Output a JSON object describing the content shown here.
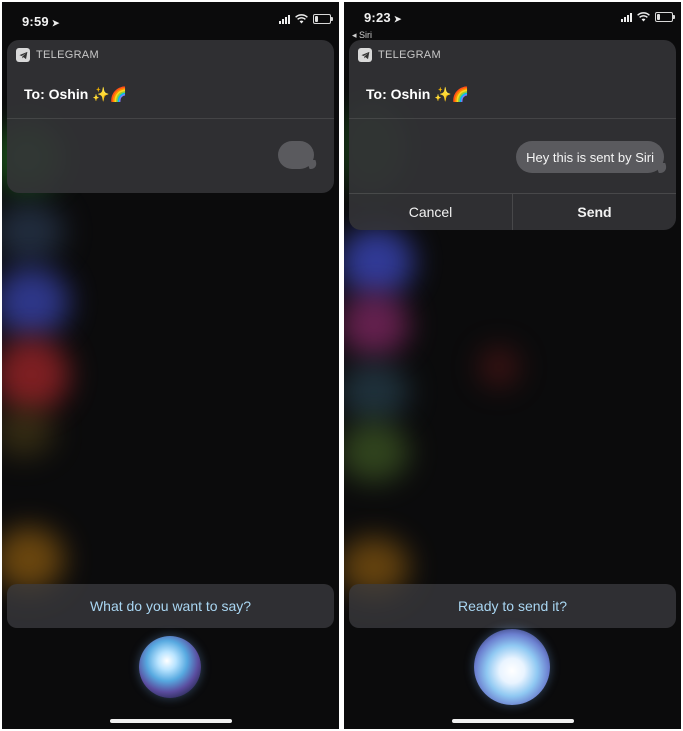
{
  "screens": [
    {
      "status": {
        "time": "9:59",
        "back": ""
      },
      "app_name": "TELEGRAM",
      "to_label": "To: Oshin ✨🌈",
      "message": "",
      "cancel_label": "",
      "send_label": "",
      "prompt": "What do you want to say?"
    },
    {
      "status": {
        "time": "9:23",
        "back": "◂ Siri"
      },
      "app_name": "TELEGRAM",
      "to_label": "To: Oshin ✨🌈",
      "message": "Hey this is sent by Siri",
      "cancel_label": "Cancel",
      "send_label": "Send",
      "prompt": "Ready to send it?"
    }
  ],
  "icons": {
    "status_left": "location-arrow-icon",
    "status_right": [
      "cellular-signal-icon",
      "wifi-icon",
      "battery-icon"
    ],
    "app": "telegram-icon",
    "assistant": "siri-orb-icon"
  },
  "colors": {
    "prompt_text": "#a9d6f2",
    "card_bg": "#343438",
    "bubble_bg": "#5a5a5e"
  }
}
